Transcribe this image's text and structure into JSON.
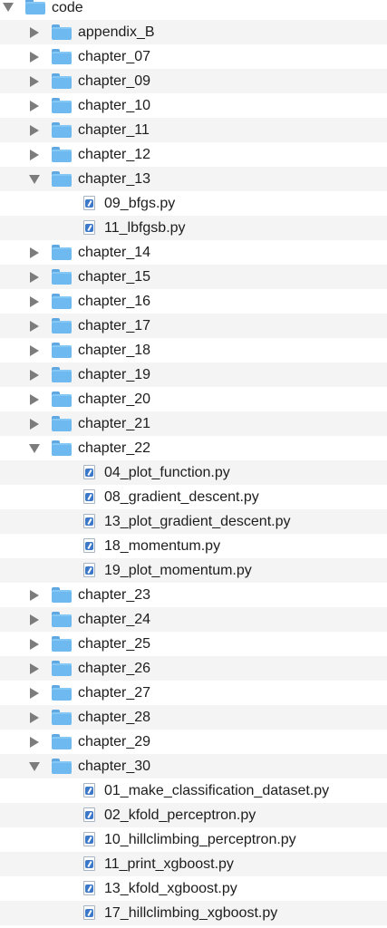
{
  "tree": {
    "root": {
      "label": "code",
      "expanded": true,
      "icon": "folder-icon"
    },
    "items": [
      {
        "type": "folder",
        "label": "appendix_B",
        "expanded": false
      },
      {
        "type": "folder",
        "label": "chapter_07",
        "expanded": false
      },
      {
        "type": "folder",
        "label": "chapter_09",
        "expanded": false
      },
      {
        "type": "folder",
        "label": "chapter_10",
        "expanded": false
      },
      {
        "type": "folder",
        "label": "chapter_11",
        "expanded": false
      },
      {
        "type": "folder",
        "label": "chapter_12",
        "expanded": false
      },
      {
        "type": "folder",
        "label": "chapter_13",
        "expanded": true
      },
      {
        "type": "file",
        "label": "09_bfgs.py"
      },
      {
        "type": "file",
        "label": "11_lbfgsb.py"
      },
      {
        "type": "folder",
        "label": "chapter_14",
        "expanded": false
      },
      {
        "type": "folder",
        "label": "chapter_15",
        "expanded": false
      },
      {
        "type": "folder",
        "label": "chapter_16",
        "expanded": false
      },
      {
        "type": "folder",
        "label": "chapter_17",
        "expanded": false
      },
      {
        "type": "folder",
        "label": "chapter_18",
        "expanded": false
      },
      {
        "type": "folder",
        "label": "chapter_19",
        "expanded": false
      },
      {
        "type": "folder",
        "label": "chapter_20",
        "expanded": false
      },
      {
        "type": "folder",
        "label": "chapter_21",
        "expanded": false
      },
      {
        "type": "folder",
        "label": "chapter_22",
        "expanded": true
      },
      {
        "type": "file",
        "label": "04_plot_function.py"
      },
      {
        "type": "file",
        "label": "08_gradient_descent.py"
      },
      {
        "type": "file",
        "label": "13_plot_gradient_descent.py"
      },
      {
        "type": "file",
        "label": "18_momentum.py"
      },
      {
        "type": "file",
        "label": "19_plot_momentum.py"
      },
      {
        "type": "folder",
        "label": "chapter_23",
        "expanded": false
      },
      {
        "type": "folder",
        "label": "chapter_24",
        "expanded": false
      },
      {
        "type": "folder",
        "label": "chapter_25",
        "expanded": false
      },
      {
        "type": "folder",
        "label": "chapter_26",
        "expanded": false
      },
      {
        "type": "folder",
        "label": "chapter_27",
        "expanded": false
      },
      {
        "type": "folder",
        "label": "chapter_28",
        "expanded": false
      },
      {
        "type": "folder",
        "label": "chapter_29",
        "expanded": false
      },
      {
        "type": "folder",
        "label": "chapter_30",
        "expanded": true
      },
      {
        "type": "file",
        "label": "01_make_classification_dataset.py"
      },
      {
        "type": "file",
        "label": "02_kfold_perceptron.py"
      },
      {
        "type": "file",
        "label": "10_hillclimbing_perceptron.py"
      },
      {
        "type": "file",
        "label": "11_print_xgboost.py"
      },
      {
        "type": "file",
        "label": "13_kfold_xgboost.py"
      },
      {
        "type": "file",
        "label": "17_hillclimbing_xgboost.py"
      }
    ]
  },
  "colors": {
    "row_alt": "#f4f4f5",
    "folder": "#6db9f0",
    "disclosure": "#7c7c7c",
    "python_mark": "#3b78c8"
  }
}
